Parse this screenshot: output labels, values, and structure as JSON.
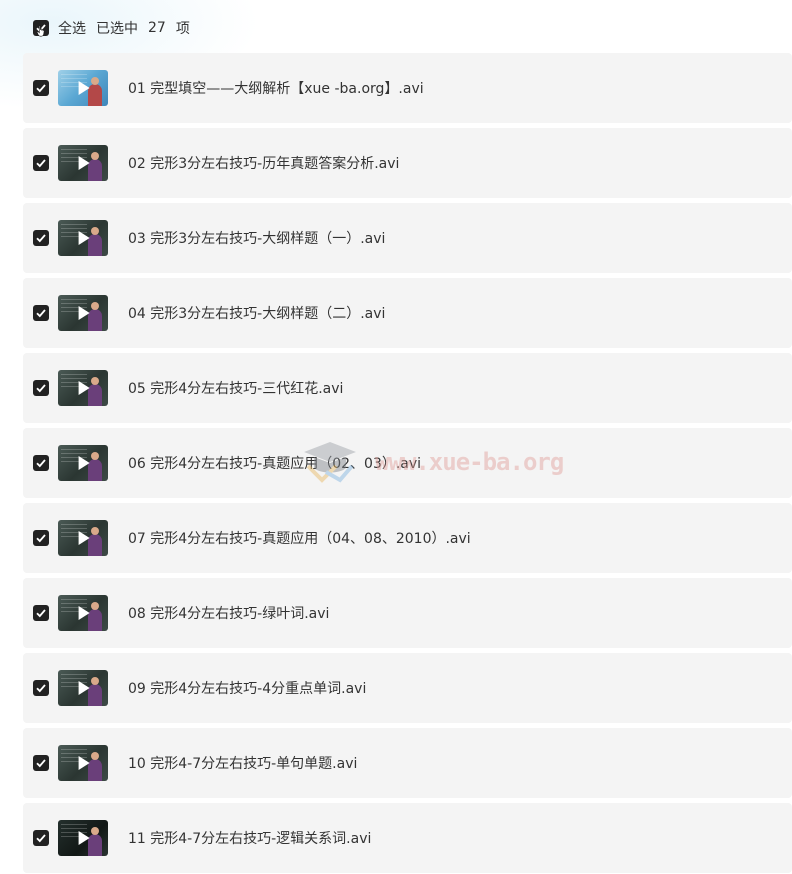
{
  "header": {
    "select_all_label": "全选",
    "selected_prefix": "已选中",
    "selected_count": "27",
    "selected_suffix": "项"
  },
  "files": [
    {
      "name": "01 完型填空——大纲解析【xue -ba.org】.avi",
      "thumb": "light"
    },
    {
      "name": "02 完形3分左右技巧-历年真题答案分析.avi",
      "thumb": "board"
    },
    {
      "name": "03 完形3分左右技巧-大纲样题（一）.avi",
      "thumb": "board"
    },
    {
      "name": "04 完形3分左右技巧-大纲样题（二）.avi",
      "thumb": "board"
    },
    {
      "name": "05 完形4分左右技巧-三代红花.avi",
      "thumb": "board"
    },
    {
      "name": "06 完形4分左右技巧-真题应用（02、03）.avi",
      "thumb": "board"
    },
    {
      "name": "07 完形4分左右技巧-真题应用（04、08、2010）.avi",
      "thumb": "board"
    },
    {
      "name": "08 完形4分左右技巧-绿叶词.avi",
      "thumb": "board"
    },
    {
      "name": "09 完形4分左右技巧-4分重点单词.avi",
      "thumb": "board"
    },
    {
      "name": "10 完形4-7分左右技巧-单句单题.avi",
      "thumb": "board"
    },
    {
      "name": "11 完形4-7分左右技巧-逻辑关系词.avi",
      "thumb": "dark"
    }
  ],
  "watermark": "www.xue-ba.org",
  "colors": {
    "row_bg": "#f4f4f4",
    "checkbox": "#222222"
  }
}
